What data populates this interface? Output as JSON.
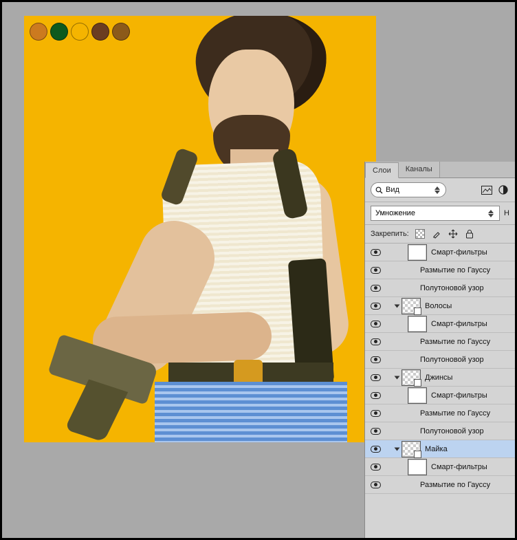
{
  "swatches": [
    "#cc7a1f",
    "#0d5a1e",
    "#f5b400",
    "#6b3d21",
    "#8c5a1a"
  ],
  "panel": {
    "tabs": {
      "layers": "Слои",
      "channels": "Каналы"
    },
    "search": {
      "placeholder": "Вид",
      "icon": "search"
    },
    "blend_mode": "Умножение",
    "opacity_label_suffix": "Н",
    "lock_label": "Закрепить:"
  },
  "layers": [
    {
      "kind": "sf-head",
      "indent": 1,
      "eye": true,
      "thumb": "white",
      "name": "Смарт-фильтры"
    },
    {
      "kind": "sf-item",
      "indent": 2,
      "eye": true,
      "name": "Размытие по Гауссу"
    },
    {
      "kind": "sf-item",
      "indent": 2,
      "eye": true,
      "name": "Полутоновой узор"
    },
    {
      "kind": "layer",
      "indent": 0,
      "eye": true,
      "thumb": "trans",
      "name": "Волосы",
      "toggle": "open"
    },
    {
      "kind": "sf-head",
      "indent": 1,
      "eye": true,
      "thumb": "white",
      "name": "Смарт-фильтры"
    },
    {
      "kind": "sf-item",
      "indent": 2,
      "eye": true,
      "name": "Размытие по Гауссу"
    },
    {
      "kind": "sf-item",
      "indent": 2,
      "eye": true,
      "name": "Полутоновой узор"
    },
    {
      "kind": "layer",
      "indent": 0,
      "eye": true,
      "thumb": "trans",
      "name": "Джинсы",
      "toggle": "open"
    },
    {
      "kind": "sf-head",
      "indent": 1,
      "eye": true,
      "thumb": "white",
      "name": "Смарт-фильтры"
    },
    {
      "kind": "sf-item",
      "indent": 2,
      "eye": true,
      "name": "Размытие по Гауссу"
    },
    {
      "kind": "sf-item",
      "indent": 2,
      "eye": true,
      "name": "Полутоновой узор"
    },
    {
      "kind": "layer",
      "indent": 0,
      "eye": true,
      "thumb": "trans",
      "name": "Майка",
      "toggle": "open",
      "selected": true
    },
    {
      "kind": "sf-head",
      "indent": 1,
      "eye": true,
      "thumb": "white",
      "name": "Смарт-фильтры"
    },
    {
      "kind": "sf-item",
      "indent": 2,
      "eye": true,
      "name": "Размытие по Гауссу"
    }
  ]
}
